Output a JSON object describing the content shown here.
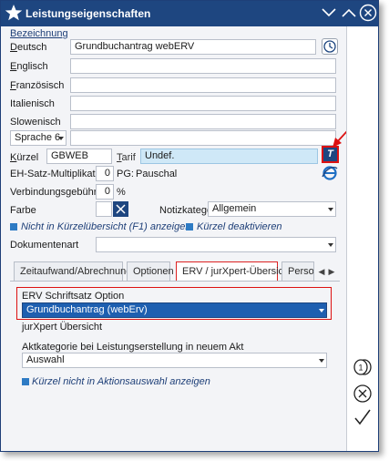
{
  "window": {
    "title": "Leistungseigenschaften",
    "accent": "#1e4680",
    "highlight": "#d11111"
  },
  "bezeichnung": {
    "section_label": "Bezeichnung",
    "deutsch_label": "Deutsch",
    "deutsch_value": "Grundbuchantrag webERV",
    "englisch_label": "Englisch",
    "englisch_value": "",
    "franzoesisch_label": "Französisch",
    "franzoesisch_value": "",
    "italienisch_label": "Italienisch",
    "italienisch_value": "",
    "slowenisch_label": "Slowenisch",
    "slowenisch_value": "",
    "sprache_select": "Sprache 6",
    "sprache_value": ""
  },
  "details": {
    "kuerzel_label": "Kürzel",
    "kuerzel_value": "GBWEB",
    "tarif_label": "Tarif",
    "tarif_value": "Undef.",
    "tarif_button": "T",
    "eh_label": "EH-Satz-Multiplikator",
    "eh_value": "0",
    "pg_label": "PG:",
    "pg_value": "Pauschal",
    "verb_label": "Verbindungsgebühr",
    "verb_value": "0",
    "verb_unit": "%",
    "farbe_label": "Farbe",
    "notiz_label": "Notizkategorie",
    "notiz_value": "Allgemein",
    "check1": "Nicht in Kürzelübersicht (F1) anzeigen",
    "check2": "Kürzel deaktivieren",
    "dokumentenart_label": "Dokumentenart",
    "dokumentenart_value": ""
  },
  "tabs": [
    {
      "label": "Zeitaufwand/Abrechnung"
    },
    {
      "label": "Optionen"
    },
    {
      "label": "ERV / jurXpert-Übersicht"
    },
    {
      "label": "Person"
    }
  ],
  "erv": {
    "label": "ERV Schriftsatz Option",
    "value": "Grundbuchantrag (webErv)",
    "section": "jurXpert Übersicht",
    "akt_label": "Aktkategorie bei Leistungserstellung in neuem Akt",
    "akt_value": "Auswahl",
    "check": "Kürzel nicht in Aktionsauswahl anzeigen"
  },
  "sidebar": {
    "icons": [
      "coins-icon",
      "cancel-icon",
      "confirm-icon"
    ]
  }
}
